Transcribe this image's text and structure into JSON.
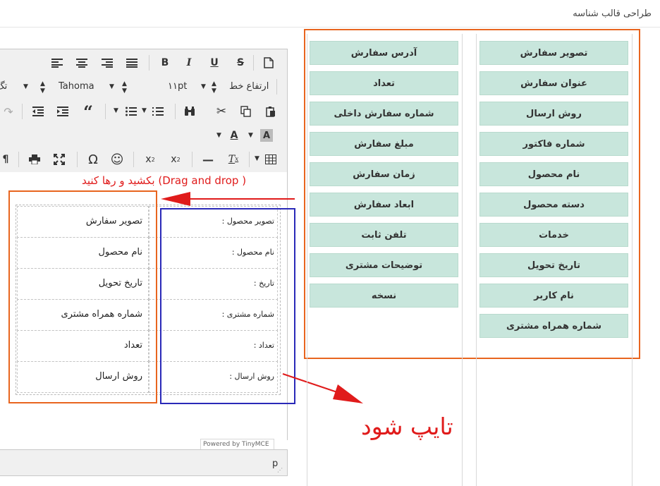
{
  "page": {
    "title": "طراحی قالب شناسه"
  },
  "toolbar": {
    "font_name": "Tahoma",
    "font_size": "۱۱pt",
    "line_height_label": "ارتفاع خط",
    "partial_label": "تگ"
  },
  "template_table": {
    "labels": [
      "تصویر محصول :",
      "نام محصول :",
      "تاریخ :",
      "شماره مشتری :",
      "تعداد :",
      "روش ارسال :"
    ],
    "values": [
      "تصویر سفارش",
      "نام محصول",
      "تاریخ تحویل",
      "شماره همراه مشتری",
      "تعداد",
      "روش ارسال"
    ]
  },
  "editor_footer": {
    "powered_by": "Powered by TinyMCE",
    "path": "p"
  },
  "annotations": {
    "drag_drop": "بکشید و رها کنید (Drag and drop )",
    "type_it": "تایپ شود",
    "annotation_color": "#e01b1b",
    "box_orange": "#e8651f",
    "box_blue": "#2a29b8"
  },
  "fields": {
    "right_column": [
      "تصویر سفارش",
      "عنوان سفارش",
      "روش ارسال",
      "شماره فاکتور",
      "نام محصول",
      "دسته محصول",
      "خدمات",
      "تاریخ تحویل",
      "نام کاربر",
      "شماره همراه مشتری"
    ],
    "left_column": [
      "آدرس سفارش",
      "تعداد",
      "شماره سفارش داخلی",
      "مبلغ سفارش",
      "زمان سفارش",
      "ابعاد سفارش",
      "تلفن ثابت",
      "توضیحات مشتری",
      "نسخه"
    ],
    "button_color": "#c8e6dc"
  }
}
